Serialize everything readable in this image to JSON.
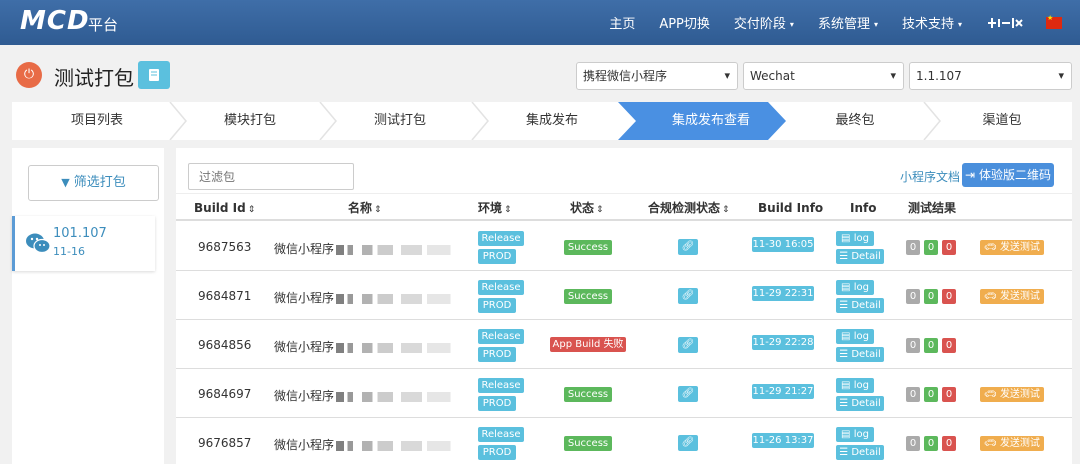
{
  "nav": {
    "brand": "MCD",
    "brand_sub": "平台",
    "items": [
      {
        "label": "主页",
        "caret": false
      },
      {
        "label": "APP切换",
        "caret": false
      },
      {
        "label": "交付阶段",
        "caret": true
      },
      {
        "label": "系统管理",
        "caret": true
      },
      {
        "label": "技术支持",
        "caret": true
      }
    ],
    "caret_glyph": "▾"
  },
  "header": {
    "title": "测试打包",
    "selects": [
      "携程微信小程序",
      "Wechat",
      "1.1.107"
    ]
  },
  "steps": [
    "项目列表",
    "模块打包",
    "测试打包",
    "集成发布",
    "集成发布查看",
    "最终包",
    "渠道包"
  ],
  "active_step_index": 4,
  "left": {
    "filter_label": "筛选打包",
    "version": {
      "num": "101.107",
      "date": "11-16"
    }
  },
  "main": {
    "search_placeholder": "过滤包",
    "doc_link": "小程序文档",
    "qr_button": "体验版二维码",
    "columns": [
      "Build Id",
      "名称",
      "环境",
      "状态",
      "合规检测状态",
      "Build Info",
      "Info",
      "测试结果"
    ],
    "sort_glyph": "⇕",
    "rows": [
      {
        "id": "9687563",
        "name": "微信小程序",
        "env1": "Release",
        "env2": "PROD",
        "status": "Success",
        "status_type": "success",
        "time": "11-30 16:05",
        "log": "log",
        "detail": "Detail",
        "scores": [
          "0",
          "0",
          "0"
        ],
        "send": "发送测试"
      },
      {
        "id": "9684871",
        "name": "微信小程序",
        "env1": "Release",
        "env2": "PROD",
        "status": "Success",
        "status_type": "success",
        "time": "11-29 22:31",
        "log": "log",
        "detail": "Detail",
        "scores": [
          "0",
          "0",
          "0"
        ],
        "send": "发送测试"
      },
      {
        "id": "9684856",
        "name": "微信小程序",
        "env1": "Release",
        "env2": "PROD",
        "status": "App Build 失败",
        "status_type": "danger",
        "time": "11-29 22:28",
        "log": "log",
        "detail": "Detail",
        "scores": [
          "0",
          "0",
          "0"
        ],
        "send": ""
      },
      {
        "id": "9684697",
        "name": "微信小程序",
        "env1": "Release",
        "env2": "PROD",
        "status": "Success",
        "status_type": "success",
        "time": "11-29 21:27",
        "log": "log",
        "detail": "Detail",
        "scores": [
          "0",
          "0",
          "0"
        ],
        "send": "发送测试"
      },
      {
        "id": "9676857",
        "name": "微信小程序",
        "env1": "Release",
        "env2": "PROD",
        "status": "Success",
        "status_type": "success",
        "time": "11-26 13:37",
        "log": "log",
        "detail": "Detail",
        "scores": [
          "0",
          "0",
          "0"
        ],
        "send": "发送测试"
      }
    ]
  },
  "colors": {
    "navbar": "#2f5b92",
    "active_step": "#4a90e2",
    "info": "#5bc0de",
    "success": "#5cb85c",
    "danger": "#d9534f",
    "warning": "#f0ad4e"
  }
}
